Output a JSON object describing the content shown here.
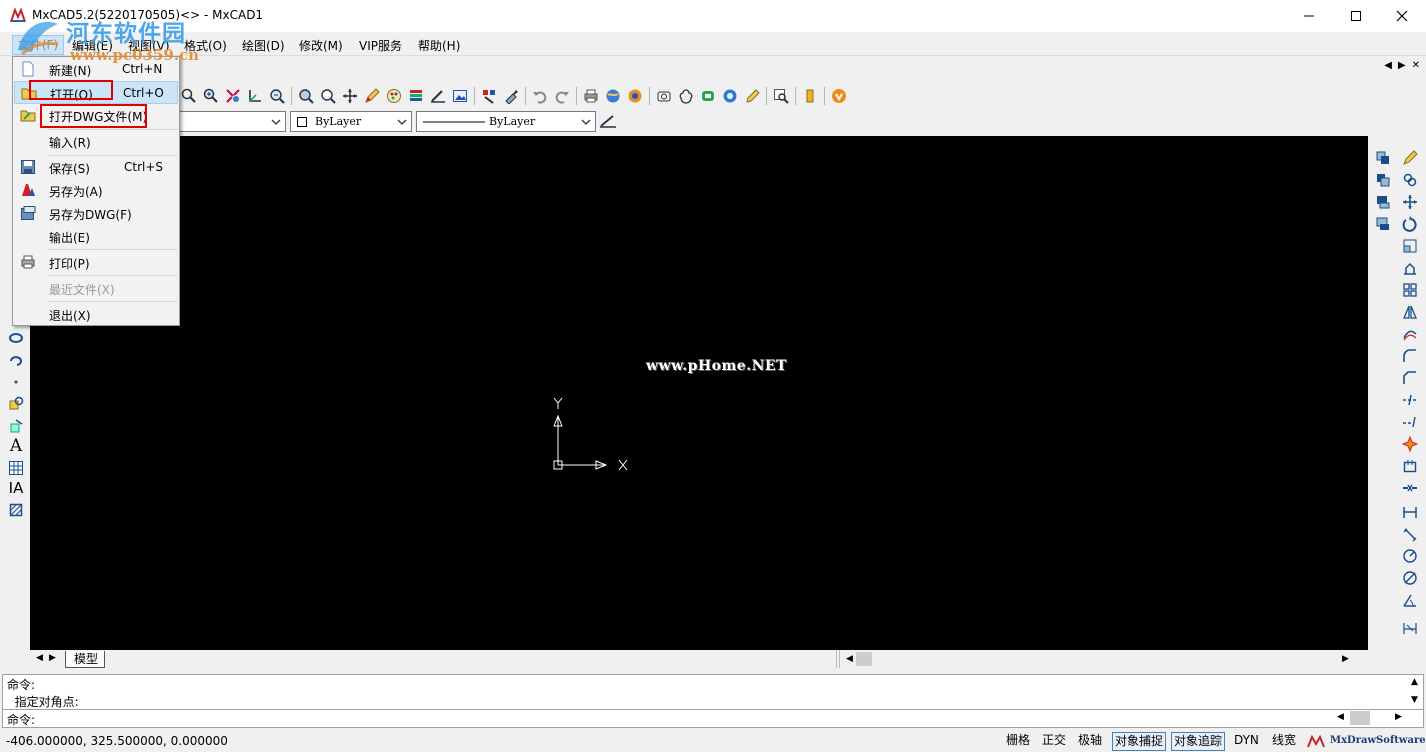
{
  "window": {
    "title": "MxCAD5.2(5220170505)<> - MxCAD1",
    "minimize": "—",
    "maximize": "☐",
    "close": "✕"
  },
  "watermark": {
    "site_name": "河东软件园",
    "url": "www.pc0359.cn",
    "canvas_text": "www.pHome.NET"
  },
  "menubar": {
    "items": [
      {
        "label": "文件(F)"
      },
      {
        "label": "编辑(E)"
      },
      {
        "label": "视图(V)"
      },
      {
        "label": "格式(O)"
      },
      {
        "label": "绘图(D)"
      },
      {
        "label": "修改(M)"
      },
      {
        "label": "VIP服务"
      },
      {
        "label": "帮助(H)"
      }
    ]
  },
  "mdi_controls": [
    "◀",
    "▶",
    "✕"
  ],
  "file_menu": {
    "items": [
      {
        "label": "新建(N)",
        "shortcut": "Ctrl+N",
        "icon": "new-file-icon"
      },
      {
        "label": "打开(O)",
        "shortcut": "Ctrl+O",
        "icon": "open-folder-icon"
      },
      {
        "label": "打开DWG文件(M)",
        "shortcut": "",
        "icon": "open-dwg-icon"
      },
      {
        "label": "输入(R)",
        "shortcut": "",
        "icon": ""
      },
      {
        "label": "保存(S)",
        "shortcut": "Ctrl+S",
        "icon": "save-icon"
      },
      {
        "label": "另存为(A)",
        "shortcut": "",
        "icon": "save-as-icon"
      },
      {
        "label": "另存为DWG(F)",
        "shortcut": "",
        "icon": "save-as-dwg-icon"
      },
      {
        "label": "输出(E)",
        "shortcut": "",
        "icon": ""
      },
      {
        "label": "打印(P)",
        "shortcut": "",
        "icon": "print-icon"
      },
      {
        "label": "最近文件(X)",
        "shortcut": "",
        "icon": ""
      },
      {
        "label": "退出(X)",
        "shortcut": "",
        "icon": ""
      }
    ]
  },
  "properties_bar": {
    "color_value": "ByLayer",
    "linetype_value": "ByLayer"
  },
  "canvas": {
    "ucs_x_label": "X",
    "ucs_y_label": "Y"
  },
  "tabs": {
    "model_tab": "模型"
  },
  "command": {
    "line1": "命令:",
    "line2": "  指定对角点:",
    "prompt": "命令:"
  },
  "status": {
    "coordinates": "-406.000000,  325.500000,  0.000000",
    "buttons": [
      {
        "label": "栅格",
        "on": false
      },
      {
        "label": "正交",
        "on": false
      },
      {
        "label": "极轴",
        "on": false
      },
      {
        "label": "对象捕捉",
        "on": true
      },
      {
        "label": "对象追踪",
        "on": true
      },
      {
        "label": "DYN",
        "on": false
      },
      {
        "label": "线宽",
        "on": false
      }
    ],
    "brand": "MxDrawSoftware"
  },
  "colors": {
    "canvas_bg": "#000000",
    "highlight": "#cce4f7",
    "annotation_red": "#e00000"
  }
}
